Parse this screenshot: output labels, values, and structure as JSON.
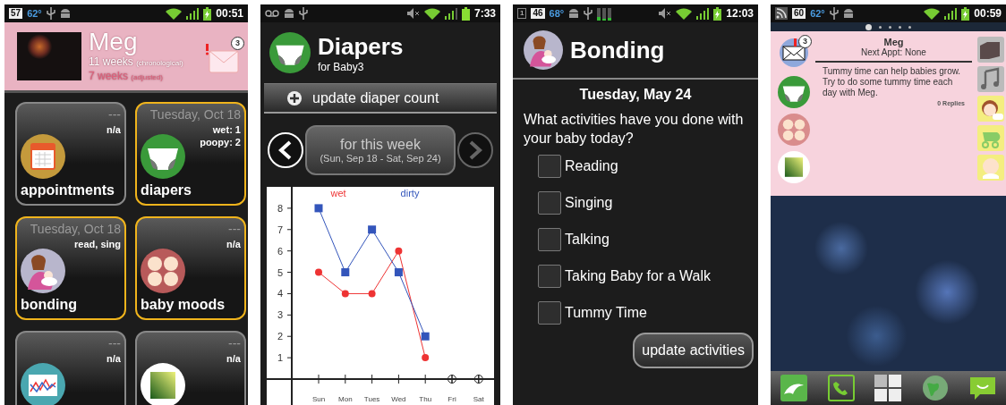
{
  "dashboard": {
    "status_bar": {
      "badge": "57",
      "temperature": "62°",
      "time": "00:51"
    },
    "profile": {
      "name": "Meg",
      "message_count": "3",
      "ages": [
        {
          "kind": "chronological",
          "value": "11 weeks",
          "note": "(chronological)"
        },
        {
          "kind": "adjusted",
          "value": "7 weeks",
          "note": "(adjusted)"
        }
      ]
    },
    "tiles": [
      {
        "kind": "calendar",
        "label": "appointments",
        "date": "---",
        "info": [
          "n/a"
        ],
        "highlighted": false
      },
      {
        "kind": "diaper",
        "label": "diapers",
        "date": "Tuesday, Oct 18",
        "info": [
          "wet: 1",
          "poopy: 2"
        ],
        "highlighted": true
      },
      {
        "kind": "mother",
        "label": "bonding",
        "date": "Tuesday, Oct 18",
        "info": [
          "read, sing"
        ],
        "highlighted": true
      },
      {
        "kind": "babies",
        "label": "baby moods",
        "date": "---",
        "info": [
          "n/a"
        ],
        "highlighted": true
      },
      {
        "kind": "chart",
        "date": "---",
        "info": [
          "n/a"
        ],
        "highlighted": false
      },
      {
        "kind": "gradient",
        "date": "---",
        "info": [
          "n/a"
        ],
        "highlighted": false
      }
    ]
  },
  "diapers": {
    "status_bar": {
      "time": "7:33"
    },
    "title": "Diapers",
    "subtitle": "for Baby3",
    "update_button": "update diaper count",
    "week": {
      "label": "for this week",
      "range": "(Sun, Sep 18 - Sat, Sep 24)",
      "prev_enabled": true,
      "next_enabled": false
    },
    "chart_data": {
      "type": "line",
      "categories": [
        "Sun",
        "Mon",
        "Tues",
        "Wed",
        "Thu",
        "Fri",
        "Sat"
      ],
      "ylim": [
        0,
        9
      ],
      "yticks": [
        1,
        2,
        3,
        4,
        5,
        6,
        7,
        8
      ],
      "series": [
        {
          "name": "wet",
          "color": "#ee3333",
          "marker": "circle",
          "values": [
            5,
            4,
            4,
            6,
            1,
            null,
            null
          ]
        },
        {
          "name": "dirty",
          "color": "#3355bb",
          "marker": "square",
          "values": [
            8,
            5,
            7,
            5,
            2,
            null,
            null
          ]
        }
      ]
    }
  },
  "bonding": {
    "status_bar": {
      "small_badge": "1",
      "badge": "46",
      "temperature": "68°",
      "time": "12:03"
    },
    "title": "Bonding",
    "date": "Tuesday, May 24",
    "question": "What activities have you done with your baby today?",
    "activities": [
      {
        "label": "Reading",
        "checked": false
      },
      {
        "label": "Singing",
        "checked": false
      },
      {
        "label": "Talking",
        "checked": false
      },
      {
        "label": "Taking Baby for a Walk",
        "checked": false
      },
      {
        "label": "Tummy Time",
        "checked": false
      }
    ],
    "update_button": "update activities"
  },
  "home": {
    "status_bar": {
      "badge": "60",
      "temperature": "62°",
      "time": "00:59"
    },
    "pages": [
      {
        "selected": true
      },
      {
        "selected": false
      },
      {
        "selected": false
      },
      {
        "selected": false
      },
      {
        "selected": false
      }
    ],
    "widget": {
      "message_count": "3",
      "name": "Meg",
      "next_appt": "Next Appt: None",
      "message": "Tummy time can help babies grow. Try to do some tummy time each day with Meg.",
      "replies": "0 Replies"
    }
  }
}
